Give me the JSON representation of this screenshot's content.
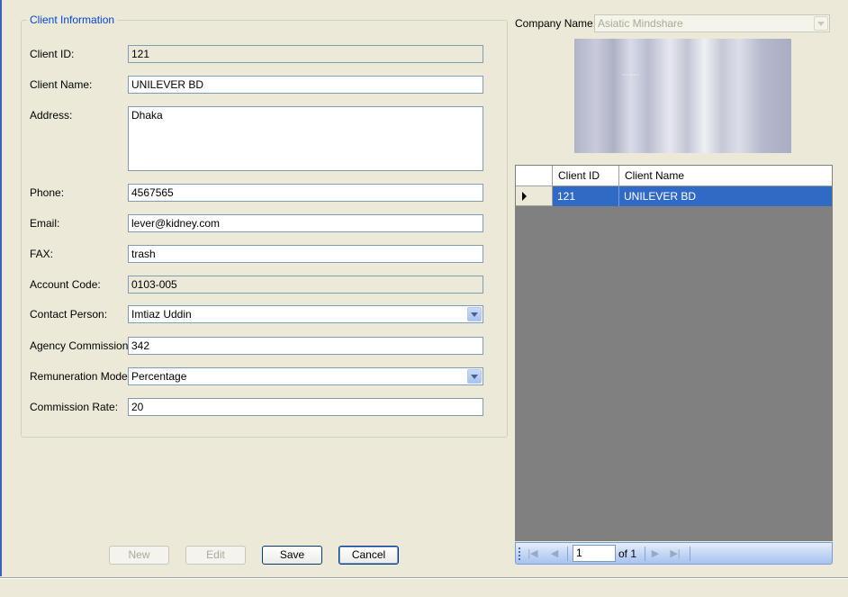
{
  "client_info": {
    "title": "Client Information",
    "fields": {
      "client_id": {
        "label": "Client ID:",
        "value": "121"
      },
      "client_name": {
        "label": "Client Name:",
        "value": "UNILEVER BD"
      },
      "address": {
        "label": "Address:",
        "value": "Dhaka"
      },
      "phone": {
        "label": "Phone:",
        "value": "4567565"
      },
      "email": {
        "label": "Email:",
        "value": "lever@kidney.com"
      },
      "fax": {
        "label": "FAX:",
        "value": "trash"
      },
      "account_code": {
        "label": "Account Code:",
        "value": "0103-005"
      },
      "contact_person": {
        "label": "Contact Person:",
        "value": "Imtiaz Uddin"
      },
      "agency_commission": {
        "label": "Agency Commission:",
        "value": "342"
      },
      "remuneration_mode": {
        "label": "Remuneration Mode:",
        "value": "Percentage"
      },
      "commission_rate": {
        "label": "Commission Rate:",
        "value": "20"
      }
    }
  },
  "buttons": {
    "new": "New",
    "edit": "Edit",
    "save": "Save",
    "cancel": "Cancel"
  },
  "company": {
    "label": "Company Name:",
    "value": "Asiatic Mindshare"
  },
  "grid": {
    "columns": [
      "Client ID",
      "Client Name"
    ],
    "rows": [
      {
        "client_id": "121",
        "client_name": "UNILEVER BD",
        "selected": true
      }
    ]
  },
  "navigator": {
    "position": "1",
    "of_label": "of 1"
  },
  "colors": {
    "window_bg": "#ece9d8",
    "selection": "#316ac5",
    "group_title": "#0046d5",
    "grid_bg": "#808080"
  }
}
